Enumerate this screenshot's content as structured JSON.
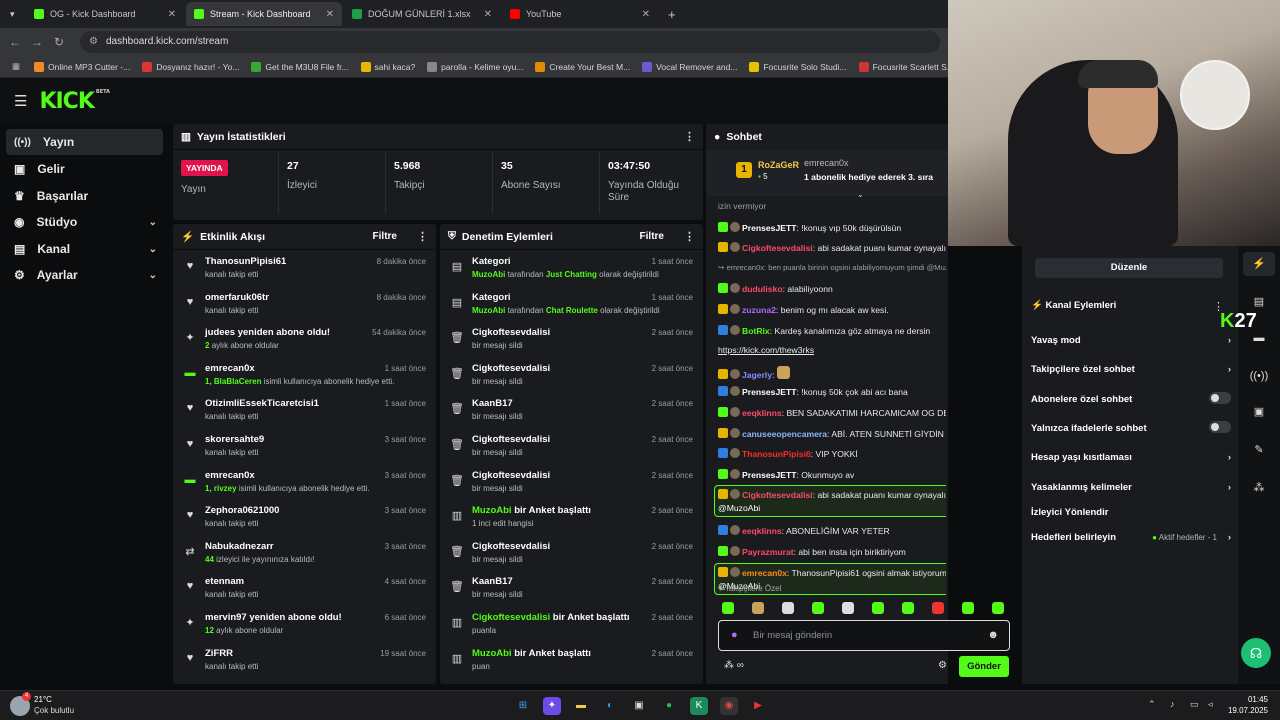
{
  "browser": {
    "tabs": [
      {
        "title": "OG - Kick Dashboard",
        "color": "#53fc18"
      },
      {
        "title": "Stream - Kick Dashboard",
        "color": "#53fc18"
      },
      {
        "title": "DOĞUM GÜNLERİ 1.xlsx",
        "color": "#1f9e4a"
      },
      {
        "title": "YouTube",
        "color": "#ff0000"
      }
    ],
    "url": "dashboard.kick.com/stream",
    "bookmarks": [
      "Online MP3 Cutter -...",
      "Dosyanız hazır! - Yo...",
      "Get the M3U8 File fr...",
      "sahi kaca?",
      "parolla - Kelime oyu...",
      "Create Your Best M...",
      "Vocal Remover and...",
      "Focusrite Solo Studi...",
      "Focusrite Scarlett S...",
      "At"
    ]
  },
  "kick": {
    "logo": "KICK",
    "logo_badge": "BETA",
    "nav": [
      {
        "label": "Yayın",
        "icon": "signal-icon"
      },
      {
        "label": "Gelir",
        "icon": "wallet-icon"
      },
      {
        "label": "Başarılar",
        "icon": "trophy-icon"
      },
      {
        "label": "Stüdyo",
        "icon": "studio-icon"
      },
      {
        "label": "Kanal",
        "icon": "channel-icon"
      },
      {
        "label": "Ayarlar",
        "icon": "gear-icon"
      }
    ]
  },
  "stats": {
    "title": "Yayın İstatistikleri",
    "live_badge": "YAYINDA",
    "live_label": "Yayın",
    "items": [
      {
        "value": "27",
        "label": "İzleyici"
      },
      {
        "value": "5.968",
        "label": "Takipçi"
      },
      {
        "value": "35",
        "label": "Abone Sayısı"
      },
      {
        "value": "03:47:50",
        "label": "Yayında Olduğu Süre"
      }
    ]
  },
  "activity": {
    "title": "Etkinlik Akışı",
    "filter": "Filtre",
    "rows": [
      {
        "name": "ThanosunPipisi61",
        "detail": "kanalı takip etti",
        "time": "8 dakika önce",
        "icon": "heart-icon"
      },
      {
        "name": "omerfaruk06tr",
        "detail": "kanalı takip etti",
        "time": "8 dakika önce",
        "icon": "heart-icon"
      },
      {
        "name": "judees yeniden abone oldu!",
        "detail_hl": "2",
        "detail": "aylık abone oldular",
        "time": "54 dakika önce",
        "icon": "sparkle-icon"
      },
      {
        "name": "emrecan0x",
        "detail_hl": "1, BlaBlaCeren",
        "detail": "isimli kullanıcıya abonelik hediye etti.",
        "time": "1 saat önce",
        "icon": "gift-icon"
      },
      {
        "name": "OtizimliEssekTicaretcisi1",
        "detail": "kanalı takip etti",
        "time": "1 saat önce",
        "icon": "heart-icon"
      },
      {
        "name": "skorersahte9",
        "detail": "kanalı takip etti",
        "time": "3 saat önce",
        "icon": "heart-icon"
      },
      {
        "name": "emrecan0x",
        "detail_hl": "1, rivzey",
        "detail": "isimli kullanıcıya abonelik hediye etti.",
        "time": "3 saat önce",
        "icon": "gift-icon"
      },
      {
        "name": "Zephora0621000",
        "detail": "kanalı takip etti",
        "time": "3 saat önce",
        "icon": "heart-icon"
      },
      {
        "name": "Nabukadnezarr",
        "detail_hl": "44",
        "detail": "izleyici ile yayınınıza katıldı!",
        "time": "3 saat önce",
        "icon": "raid-icon"
      },
      {
        "name": "etennam",
        "detail": "kanalı takip etti",
        "time": "4 saat önce",
        "icon": "heart-icon"
      },
      {
        "name": "mervin97 yeniden abone oldu!",
        "detail_hl": "12",
        "detail": "aylık abone oldular",
        "time": "6 saat önce",
        "icon": "sparkle-icon"
      },
      {
        "name": "ZiFRR",
        "detail": "kanalı takip etti",
        "time": "19 saat önce",
        "icon": "heart-icon"
      }
    ]
  },
  "moderation": {
    "title": "Denetim Eylemleri",
    "filter": "Filtre",
    "rows": [
      {
        "name": "Kategori",
        "actor": "MuzoAbi",
        "mid": "tarafından",
        "target": "Just Chatting",
        "tail": "olarak değiştirildi",
        "time": "1 saat önce",
        "icon": "category-icon"
      },
      {
        "name": "Kategori",
        "actor": "MuzoAbi",
        "mid": "tarafından",
        "target": "Chat Roulette",
        "tail": "olarak değiştirildi",
        "time": "1 saat önce",
        "icon": "category-icon"
      },
      {
        "name": "Cigkoftesevdalisi",
        "detail": "bir mesajı sildi",
        "time": "2 saat önce",
        "icon": "trash-icon"
      },
      {
        "name": "Cigkoftesevdalisi",
        "detail": "bir mesajı sildi",
        "time": "2 saat önce",
        "icon": "trash-icon"
      },
      {
        "name": "KaanB17",
        "detail": "bir mesajı sildi",
        "time": "2 saat önce",
        "icon": "trash-icon"
      },
      {
        "name": "Cigkoftesevdalisi",
        "detail": "bir mesajı sildi",
        "time": "2 saat önce",
        "icon": "trash-icon"
      },
      {
        "name": "Cigkoftesevdalisi",
        "detail": "bir mesajı sildi",
        "time": "2 saat önce",
        "icon": "trash-icon"
      },
      {
        "actor": "MuzoAbi",
        "name": "bir Anket başlattı",
        "detail": "1 inci edit hangisi",
        "time": "2 saat önce",
        "icon": "poll-icon"
      },
      {
        "name": "Cigkoftesevdalisi",
        "detail": "bir mesajı sildi",
        "time": "2 saat önce",
        "icon": "trash-icon"
      },
      {
        "name": "KaanB17",
        "detail": "bir mesajı sildi",
        "time": "2 saat önce",
        "icon": "trash-icon"
      },
      {
        "actor": "Cigkoftesevdalisi",
        "name": "bir Anket başlattı",
        "detail": "puanla",
        "time": "2 saat önce",
        "icon": "poll-icon"
      },
      {
        "actor": "MuzoAbi",
        "name": "bir Anket başlattı",
        "detail": "puan",
        "time": "2 saat önce",
        "icon": "poll-icon"
      }
    ]
  },
  "chat": {
    "title": "Sohbet",
    "pinned": {
      "user": "RoZaGeR",
      "level": "5",
      "gifter": "emrecan0x",
      "text": "1 abonelik hediye ederek 3. sıra"
    },
    "messages": [
      {
        "user": "",
        "text": "izin vermiyor",
        "color": "#9aa0a6"
      },
      {
        "user": "PrensesJETT",
        "text": "!konuş vıp 50k düşürülsün",
        "color": "#ffffff"
      },
      {
        "user": "Cigkoftesevdalisi",
        "text": "abi sadakat puanı kumar oynayalım",
        "color": "#ff4a6a"
      },
      {
        "user": "emrecan0x:",
        "text": "ben puanla birinin ogsini alabiliyomuyum şimdi @MuzoAbi...",
        "color": "#9aa0a6",
        "reply": true
      },
      {
        "user": "dudulisko",
        "text": "alabiliyoonn",
        "color": "#ff4a6a"
      },
      {
        "user": "zuzuna2",
        "text": "benim og mı alacak aw kesi.",
        "color": "#b069ff"
      },
      {
        "user": "BotRix",
        "text": "Kardeş kanalımıza göz atmaya ne dersin",
        "color": "#53fc18"
      },
      {
        "user": "",
        "text": "https://kick.com/thew3rks",
        "color": "#ffffff",
        "link": true
      },
      {
        "user": "Jagerly",
        "text": "",
        "color": "#8b8cff"
      },
      {
        "user": "PrensesJETT",
        "text": "!konuş 50k çok abi acı bana",
        "color": "#ffffff"
      },
      {
        "user": "eeqklinns",
        "text": "BEN SADAKATIMI HARCAMICAM OG DE İSTEMİYOM",
        "color": "#ff4a6a"
      },
      {
        "user": "canuseeopencamera",
        "text": "ABİ. ATEN SUNNETİ GİYDİN",
        "color": "#8bb7ff"
      },
      {
        "user": "ThanosunPipisi6",
        "text": "VIP YOKKİ",
        "color": "#ff2a2a"
      },
      {
        "user": "PrensesJETT",
        "text": "Okunmuyo av",
        "color": "#ffffff"
      },
      {
        "user": "Cigkoftesevdalisi",
        "text": "abi sadakat puanı kumar oynayalım",
        "color": "#ff4a6a",
        "mention": "@MuzoAbi",
        "highlight": true
      },
      {
        "user": "eeqklinns",
        "text": "ABONELİĞİM VAR YETER",
        "color": "#ff4a6a"
      },
      {
        "user": "Payrazmurat",
        "text": "abi ben insta için biriktiriyom",
        "color": "#ff4a6a"
      },
      {
        "user": "emrecan0x",
        "text": "ThanosunPipisi61 ogsini almak istiyorum",
        "color": "#ff8a1a",
        "mention": "@MuzoAbi",
        "highlight": true
      }
    ],
    "mode_label": "Takipçilere Özel",
    "input_placeholder": "Bir mesaj gönderin",
    "send_label": "Gönder"
  },
  "right": {
    "edit_button": "Düzenle",
    "section_title": "Kanal Eylemleri",
    "items": [
      {
        "label": "Yavaş mod",
        "control": "chevron"
      },
      {
        "label": "Takipçilere özel sohbet",
        "control": "chevron"
      },
      {
        "label": "Abonelere özel sohbet",
        "control": "toggle"
      },
      {
        "label": "Yalnızca ifadelerle sohbet",
        "control": "toggle"
      },
      {
        "label": "Hesap yaşı kısıtlaması",
        "control": "chevron"
      },
      {
        "label": "Yasaklanmış kelimeler",
        "control": "chevron"
      },
      {
        "label": "İzleyici Yönlendir",
        "control": "none"
      },
      {
        "label": "Hedefleri belirleyin",
        "control": "chevron",
        "extra": "Aktif hedefler - 1"
      }
    ],
    "viewer_count": "27"
  },
  "taskbar": {
    "temp": "21°C",
    "weather": "Çok bulutlu",
    "weather_badge": "4",
    "time": "01:45",
    "date": "19.07.2025"
  },
  "colors": {
    "accent": "#53fc18",
    "live": "#e1134c",
    "panel": "#191b1f"
  }
}
